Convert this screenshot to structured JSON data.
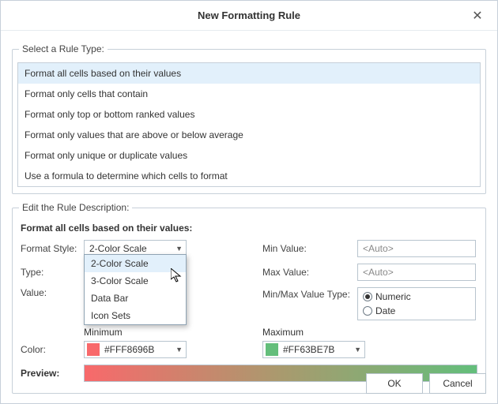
{
  "window": {
    "title": "New Formatting Rule"
  },
  "ruleTypeGroup": {
    "legend": "Select a Rule Type:",
    "items": [
      "Format all cells based on their values",
      "Format only cells that contain",
      "Format only top or bottom ranked values",
      "Format only values that are above or below average",
      "Format only unique or duplicate values",
      "Use a formula to determine which cells to format"
    ],
    "selectedIndex": 0
  },
  "descGroup": {
    "legend": "Edit the Rule Description:",
    "heading": "Format all cells based on their values:",
    "labels": {
      "formatStyle": "Format Style:",
      "type": "Type:",
      "value": "Value:",
      "minValue": "Min Value:",
      "maxValue": "Max Value:",
      "minMaxType": "Min/Max Value Type:",
      "color": "Color:",
      "minimum": "Minimum",
      "maximum": "Maximum",
      "preview": "Preview:"
    },
    "formatStyle": {
      "value": "2-Color Scale",
      "options": [
        "2-Color Scale",
        "3-Color Scale",
        "Data Bar",
        "Icon Sets"
      ]
    },
    "minValue": "<Auto>",
    "maxValue": "<Auto>",
    "minMaxType": {
      "numeric": "Numeric",
      "date": "Date",
      "selected": "numeric"
    },
    "colors": {
      "min": {
        "hex": "#F8696B",
        "text": "#FFF8696B"
      },
      "max": {
        "hex": "#63BE7B",
        "text": "#FF63BE7B"
      }
    }
  },
  "buttons": {
    "ok": "OK",
    "cancel": "Cancel"
  }
}
